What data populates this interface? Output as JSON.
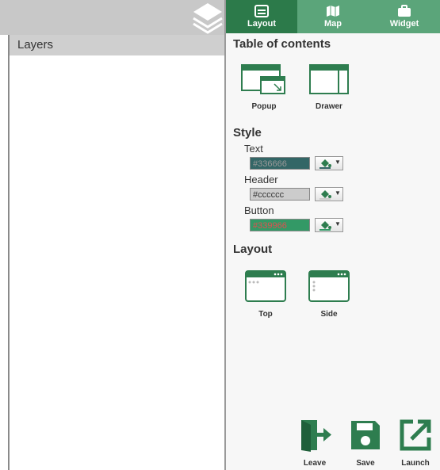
{
  "layers_panel": {
    "title": "Layers"
  },
  "tabs": [
    {
      "label": "Layout",
      "icon": "layout-icon",
      "active": true
    },
    {
      "label": "Map",
      "icon": "map-icon",
      "active": false
    },
    {
      "label": "Widget",
      "icon": "briefcase-icon",
      "active": false
    }
  ],
  "toc": {
    "title": "Table of contents",
    "options": [
      {
        "label": "Popup",
        "icon": "popup-icon"
      },
      {
        "label": "Drawer",
        "icon": "drawer-icon"
      }
    ]
  },
  "style": {
    "title": "Style",
    "fields": [
      {
        "label": "Text",
        "value": "#336666",
        "swatch": "#336666",
        "text_color": "#9a9a9a"
      },
      {
        "label": "Header",
        "value": "#cccccc",
        "swatch": "#cccccc",
        "text_color": "#333333"
      },
      {
        "label": "Button",
        "value": "#339966",
        "swatch": "#339966",
        "text_color": "#e05050"
      }
    ]
  },
  "layout": {
    "title": "Layout",
    "options": [
      {
        "label": "Top",
        "icon": "layout-top-icon"
      },
      {
        "label": "Side",
        "icon": "layout-side-icon"
      }
    ]
  },
  "actions": [
    {
      "label": "Leave",
      "icon": "leave-icon"
    },
    {
      "label": "Save",
      "icon": "save-icon"
    },
    {
      "label": "Launch",
      "icon": "launch-icon"
    }
  ],
  "colors": {
    "accent": "#2c7a4a",
    "tab_bar": "#5ba57a",
    "icon": "#2e7d4f"
  }
}
